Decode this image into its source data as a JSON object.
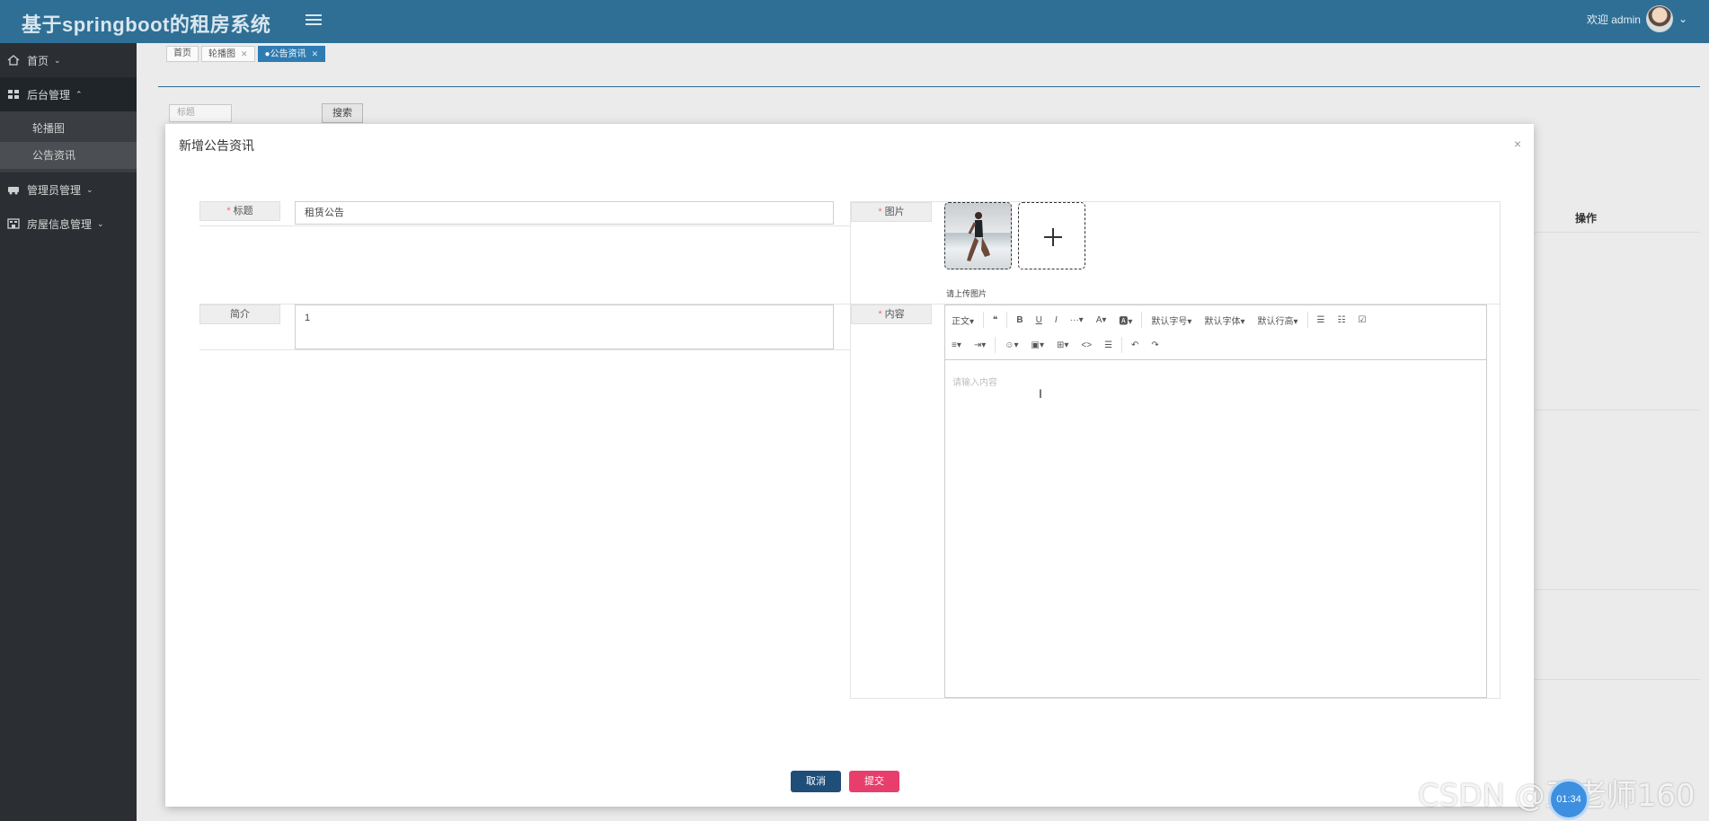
{
  "header": {
    "app_title": "基于springboot的租房系统",
    "welcome": "欢迎 admin",
    "menu_icon": "hamburger-icon"
  },
  "sidebar": {
    "items": [
      {
        "label": "首页",
        "icon": "home-icon"
      },
      {
        "label": "后台管理",
        "icon": "grid-icon",
        "sub": [
          "轮播图",
          "公告资讯"
        ]
      },
      {
        "label": "管理员管理",
        "icon": "car-icon"
      },
      {
        "label": "房屋信息管理",
        "icon": "building-icon"
      }
    ]
  },
  "tabs": [
    {
      "label": "首页",
      "closable": false
    },
    {
      "label": "轮播图",
      "closable": true
    },
    {
      "label": "●公告资讯",
      "closable": true,
      "active": true
    }
  ],
  "page": {
    "search_placeholder": "标题",
    "search_button": "搜索",
    "operation_column": "操作"
  },
  "modal": {
    "title": "新增公告资讯",
    "close": "×",
    "fields": {
      "title_label": "标题",
      "title_value": "租赁公告",
      "intro_label": "简介",
      "intro_value": "1",
      "image_label": "图片",
      "image_tip": "请上传图片",
      "content_label": "内容",
      "content_placeholder": "请输入内容"
    },
    "toolbar_row1": [
      "正文▾",
      "❝",
      "B",
      "U",
      "I",
      "···▾",
      "A▾",
      "🅰▾",
      "默认字号▾",
      "默认字体▾",
      "默认行高▾",
      "☰",
      "☷",
      "☑"
    ],
    "toolbar_row2": [
      "≡▾",
      "⇥▾",
      "☺▾",
      "▣▾",
      "⊞▾",
      "<>",
      "☰",
      "↶",
      "↷"
    ],
    "cancel": "取消",
    "submit": "提交"
  },
  "overlay": {
    "watermark": "CSDN @王老师160",
    "timer": "01:34"
  }
}
